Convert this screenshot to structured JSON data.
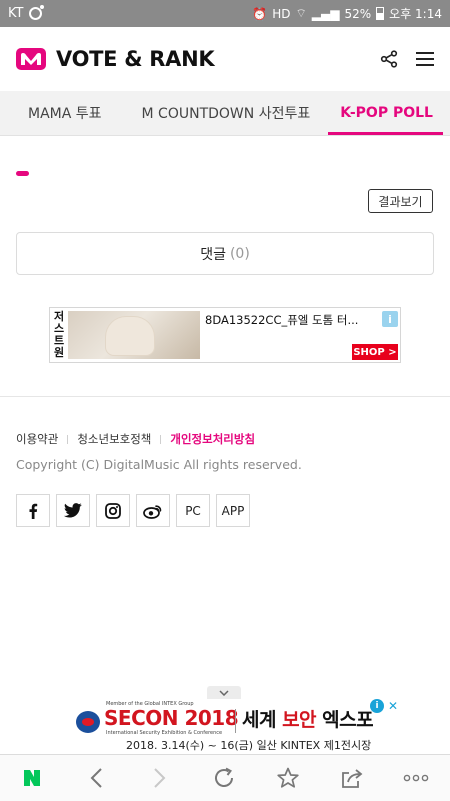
{
  "status_bar": {
    "carrier": "KT",
    "network": "HD",
    "battery": "52%",
    "time": "오후 1:14"
  },
  "header": {
    "title": "VOTE & RANK"
  },
  "tabs": [
    {
      "label": "MAMA 투표",
      "active": false
    },
    {
      "label": "M COUNTDOWN 사전투표",
      "active": false
    },
    {
      "label": "K-POP POLL",
      "active": true
    }
  ],
  "main": {
    "result_button": "결과보기",
    "comment_label": "댓글",
    "comment_count": "(0)"
  },
  "ad_banner": {
    "brand_vertical": [
      "저",
      "스",
      "트",
      "원"
    ],
    "text": "8DA13522CC_퓨엘 도톰 터...",
    "info": "i",
    "shop_label": "SHOP >"
  },
  "footer": {
    "links": [
      "이용약관",
      "청소년보호정책",
      "개인정보처리방침"
    ],
    "copyright": "Copyright (C) DigitalMusic All rights reserved.",
    "social": [
      "PC",
      "APP"
    ]
  },
  "bottom_ad": {
    "small_top": "Member of the Global INTEX Group",
    "brand": "SECON 2018",
    "brand_sub": "International Security Exhibition & Conference",
    "korean_title_a": "세계 ",
    "korean_title_b": "보안",
    "korean_title_c": " 엑스포",
    "date": "2018. 3.14(수) ~ 16(금)  일산 KINTEX 제1전시장"
  },
  "colors": {
    "accent": "#e5077e",
    "status_bar": "#8a8a8a",
    "naver_green": "#03c75a"
  }
}
